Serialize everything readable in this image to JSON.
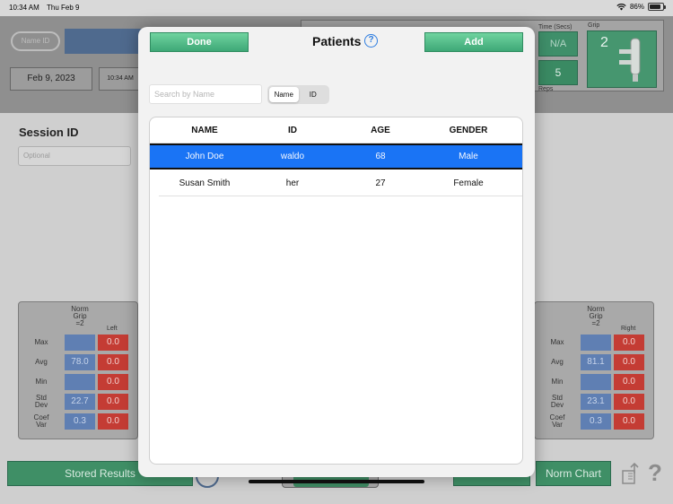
{
  "status_bar": {
    "time": "10:34 AM",
    "date": "Thu Feb 9",
    "battery": "86%",
    "battery_level": 0.86
  },
  "background": {
    "name_id_label": "Name ID",
    "date": "Feb 9, 2023",
    "time": "10:34 AM",
    "time_secs_label": "Time (Secs)",
    "time_secs_value": "N/A",
    "reps_label": "Reps",
    "reps_value": "5",
    "grip_label": "Grip",
    "grip_value": "2",
    "session_label": "Session ID",
    "session_placeholder": "Optional",
    "left_panel": {
      "norm_head": "Norm\nGrip\n=2",
      "side": "Left",
      "rows": [
        {
          "label": "Max",
          "norm": "",
          "value": "0.0"
        },
        {
          "label": "Avg",
          "norm": "78.0",
          "value": "0.0"
        },
        {
          "label": "Min",
          "norm": "",
          "value": "0.0"
        },
        {
          "label": "Std\nDev",
          "norm": "22.7",
          "value": "0.0"
        },
        {
          "label": "Coef\nVar",
          "norm": "0.3",
          "value": "0.0"
        }
      ]
    },
    "right_panel": {
      "norm_head": "Norm\nGrip\n=2",
      "side": "Right",
      "rows": [
        {
          "label": "Max",
          "norm": "",
          "value": "0.0"
        },
        {
          "label": "Avg",
          "norm": "81.1",
          "value": "0.0"
        },
        {
          "label": "Min",
          "norm": "",
          "value": "0.0"
        },
        {
          "label": "Std\nDev",
          "norm": "23.1",
          "value": "0.0"
        },
        {
          "label": "Coef\nVar",
          "norm": "0.3",
          "value": "0.0"
        }
      ]
    },
    "stored_results_label": "Stored Results",
    "norm_chart_label": "Norm Chart",
    "help_glyph": "?"
  },
  "modal": {
    "done_label": "Done",
    "title": "Patients",
    "help_glyph": "?",
    "add_label": "Add",
    "search_placeholder": "Search by Name",
    "segments": [
      "Name",
      "ID"
    ],
    "selected_segment": "Name",
    "columns": [
      "NAME",
      "ID",
      "AGE",
      "GENDER"
    ],
    "patients": [
      {
        "name": "John Doe",
        "id": "waldo",
        "age": "68",
        "gender": "Male",
        "selected": true
      },
      {
        "name": "Susan Smith",
        "id": "her",
        "age": "27",
        "gender": "Female",
        "selected": false
      }
    ],
    "colors": {
      "selected_row": "#1a74f5",
      "button_green": "#3ea877",
      "help_blue": "#2e7de0"
    }
  }
}
